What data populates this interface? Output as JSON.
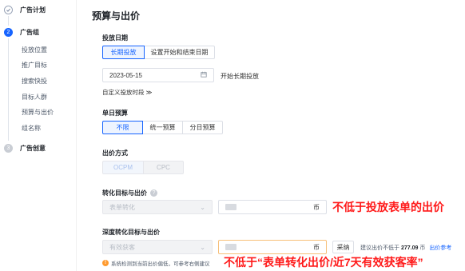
{
  "sidebar": {
    "steps": [
      {
        "label": "广告计划"
      },
      {
        "label": "广告组",
        "number": "2"
      },
      {
        "label": "广告创意",
        "number": "3"
      }
    ],
    "sub_items": [
      "投放位置",
      "推广目标",
      "搜索快投",
      "目标人群",
      "预算与出价",
      "组名称"
    ]
  },
  "main": {
    "title": "预算与出价",
    "schedule": {
      "label": "投放日期",
      "options": [
        "长期投放",
        "设置开始和结束日期"
      ],
      "selected": "长期投放",
      "date_value": "2023-05-15",
      "start_text": "开始长期投放",
      "custom_time_label": "自定义投放时段 ≫"
    },
    "budget": {
      "label": "单日预算",
      "options": [
        "不限",
        "统一预算",
        "分日预算"
      ],
      "selected": "不限"
    },
    "bid_method": {
      "label": "出价方式",
      "options": [
        "OCPM",
        "CPC"
      ],
      "selected": "OCPM"
    },
    "conversion": {
      "label": "转化目标与出价",
      "select_value": "表单转化",
      "currency": "币",
      "annotation": "不低于投放表单的出价"
    },
    "deep_conversion": {
      "label": "深度转化目标与出价",
      "select_value": "有效获客",
      "currency": "币",
      "adopt_button": "采纳",
      "suggest_text": "建议出价不低于",
      "suggest_value": "277.09",
      "suggest_unit": "币",
      "reference_link": "出价参考",
      "warning_text": "系统检测到当前出价偏低，可参考右侧建议",
      "annotation": "不低于“表单转化出价/近7天有效获客率”"
    }
  },
  "colors": {
    "accent": "#1664ff",
    "annotation_red": "#ff1a1a",
    "warning": "#ff9a2e"
  }
}
